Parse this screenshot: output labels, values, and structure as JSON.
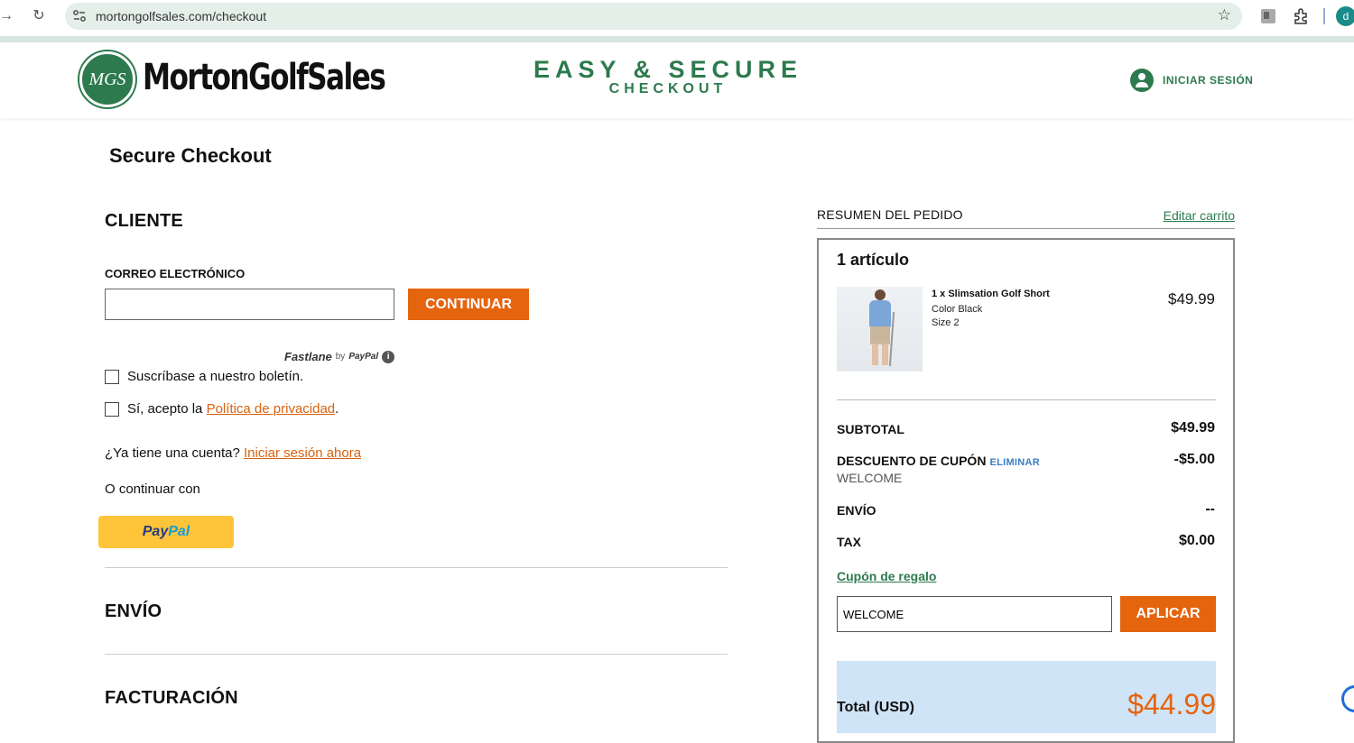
{
  "browser": {
    "url": "mortongolfsales.com/checkout",
    "profile_initial": "d"
  },
  "header": {
    "logo_badge": "MGS",
    "logo_text": "MortonGolfSales",
    "tagline_main": "EASY & SECURE",
    "tagline_sub": "CHECKOUT",
    "login_label": "INICIAR SESIÓN",
    "brand_color": "#2d7a4e"
  },
  "checkout": {
    "page_title": "Secure Checkout",
    "customer": {
      "title": "CLIENTE",
      "email_label": "CORREO ELECTRÓNICO",
      "email_value": "",
      "continue_label": "CONTINUAR",
      "fastlane": "Fastlane",
      "fastlane_by": "by",
      "fastlane_paypal": "PayPal",
      "newsletter_label": "Suscríbase a nuestro boletín.",
      "privacy_prefix": "Sí, acepto la ",
      "privacy_link": "Política de privacidad",
      "privacy_suffix": ".",
      "account_prompt": "¿Ya tiene una cuenta? ",
      "login_link": "Iniciar sesión ahora",
      "or_continue": "O continuar con",
      "paypal_p1": "Pay",
      "paypal_p2": "Pal"
    },
    "shipping_title": "ENVÍO",
    "billing_title": "FACTURACIÓN",
    "accent_color": "#e5640e"
  },
  "summary": {
    "heading": "RESUMEN DEL PEDIDO",
    "edit_cart": "Editar carrito",
    "items_count": "1 artículo",
    "item": {
      "name": "1 x Slimsation Golf Short",
      "color": "Color Black",
      "size": "Size 2",
      "price": "$49.99"
    },
    "subtotal_label": "SUBTOTAL",
    "subtotal_value": "$49.99",
    "discount_label": "DESCUENTO DE CUPÓN",
    "discount_remove": "ELIMINAR",
    "discount_code": "WELCOME",
    "discount_value": "-$5.00",
    "shipping_label": "ENVÍO",
    "shipping_value": "--",
    "tax_label": "TAX",
    "tax_value": "$0.00",
    "gift_coupon": "Cupón de regalo",
    "coupon_input_value": "WELCOME",
    "apply_label": "APLICAR",
    "total_label": "Total (USD)",
    "total_value": "$44.99"
  }
}
